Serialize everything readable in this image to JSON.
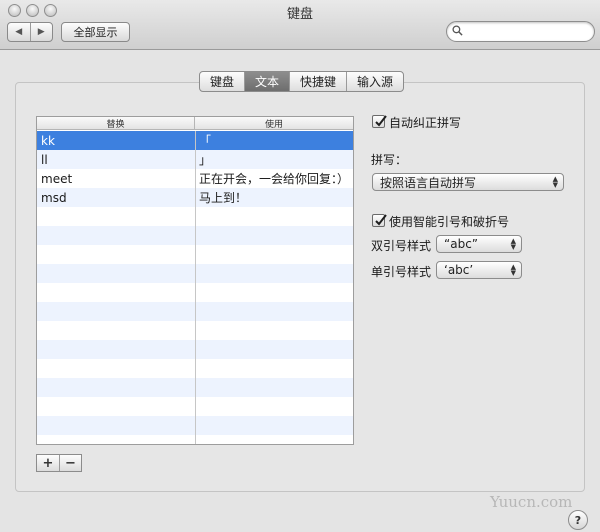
{
  "window": {
    "title": "键盘"
  },
  "toolbar": {
    "back": "◀",
    "forward": "▶",
    "show_all": "全部显示",
    "search_placeholder": ""
  },
  "tabs": [
    {
      "label": "键盘",
      "active": false
    },
    {
      "label": "文本",
      "active": true
    },
    {
      "label": "快捷键",
      "active": false
    },
    {
      "label": "输入源",
      "active": false
    }
  ],
  "table": {
    "headers": [
      "替换",
      "使用"
    ],
    "rows": [
      {
        "replace": "kk",
        "with": "「",
        "selected": true
      },
      {
        "replace": "ll",
        "with": "」",
        "selected": false
      },
      {
        "replace": "meet",
        "with": "正在开会，一会给你回复：）",
        "selected": false
      },
      {
        "replace": "msd",
        "with": "马上到！",
        "selected": false
      }
    ],
    "empty_rows": 13,
    "add_label": "+",
    "remove_label": "−"
  },
  "options": {
    "auto_correct": {
      "label": "自动纠正拼写",
      "checked": true
    },
    "spelling_label": "拼写：",
    "spelling_value": "按照语言自动拼写",
    "smart_quotes": {
      "label": "使用智能引号和破折号",
      "checked": true
    },
    "double_quote_label": "双引号样式",
    "double_quote_value": "“abc”",
    "single_quote_label": "单引号样式",
    "single_quote_value": "‘abc’"
  },
  "help_label": "?",
  "watermark": "Yuucn.com",
  "colors": {
    "selection": "#3d80df",
    "alt_row": "#edf3fe"
  }
}
